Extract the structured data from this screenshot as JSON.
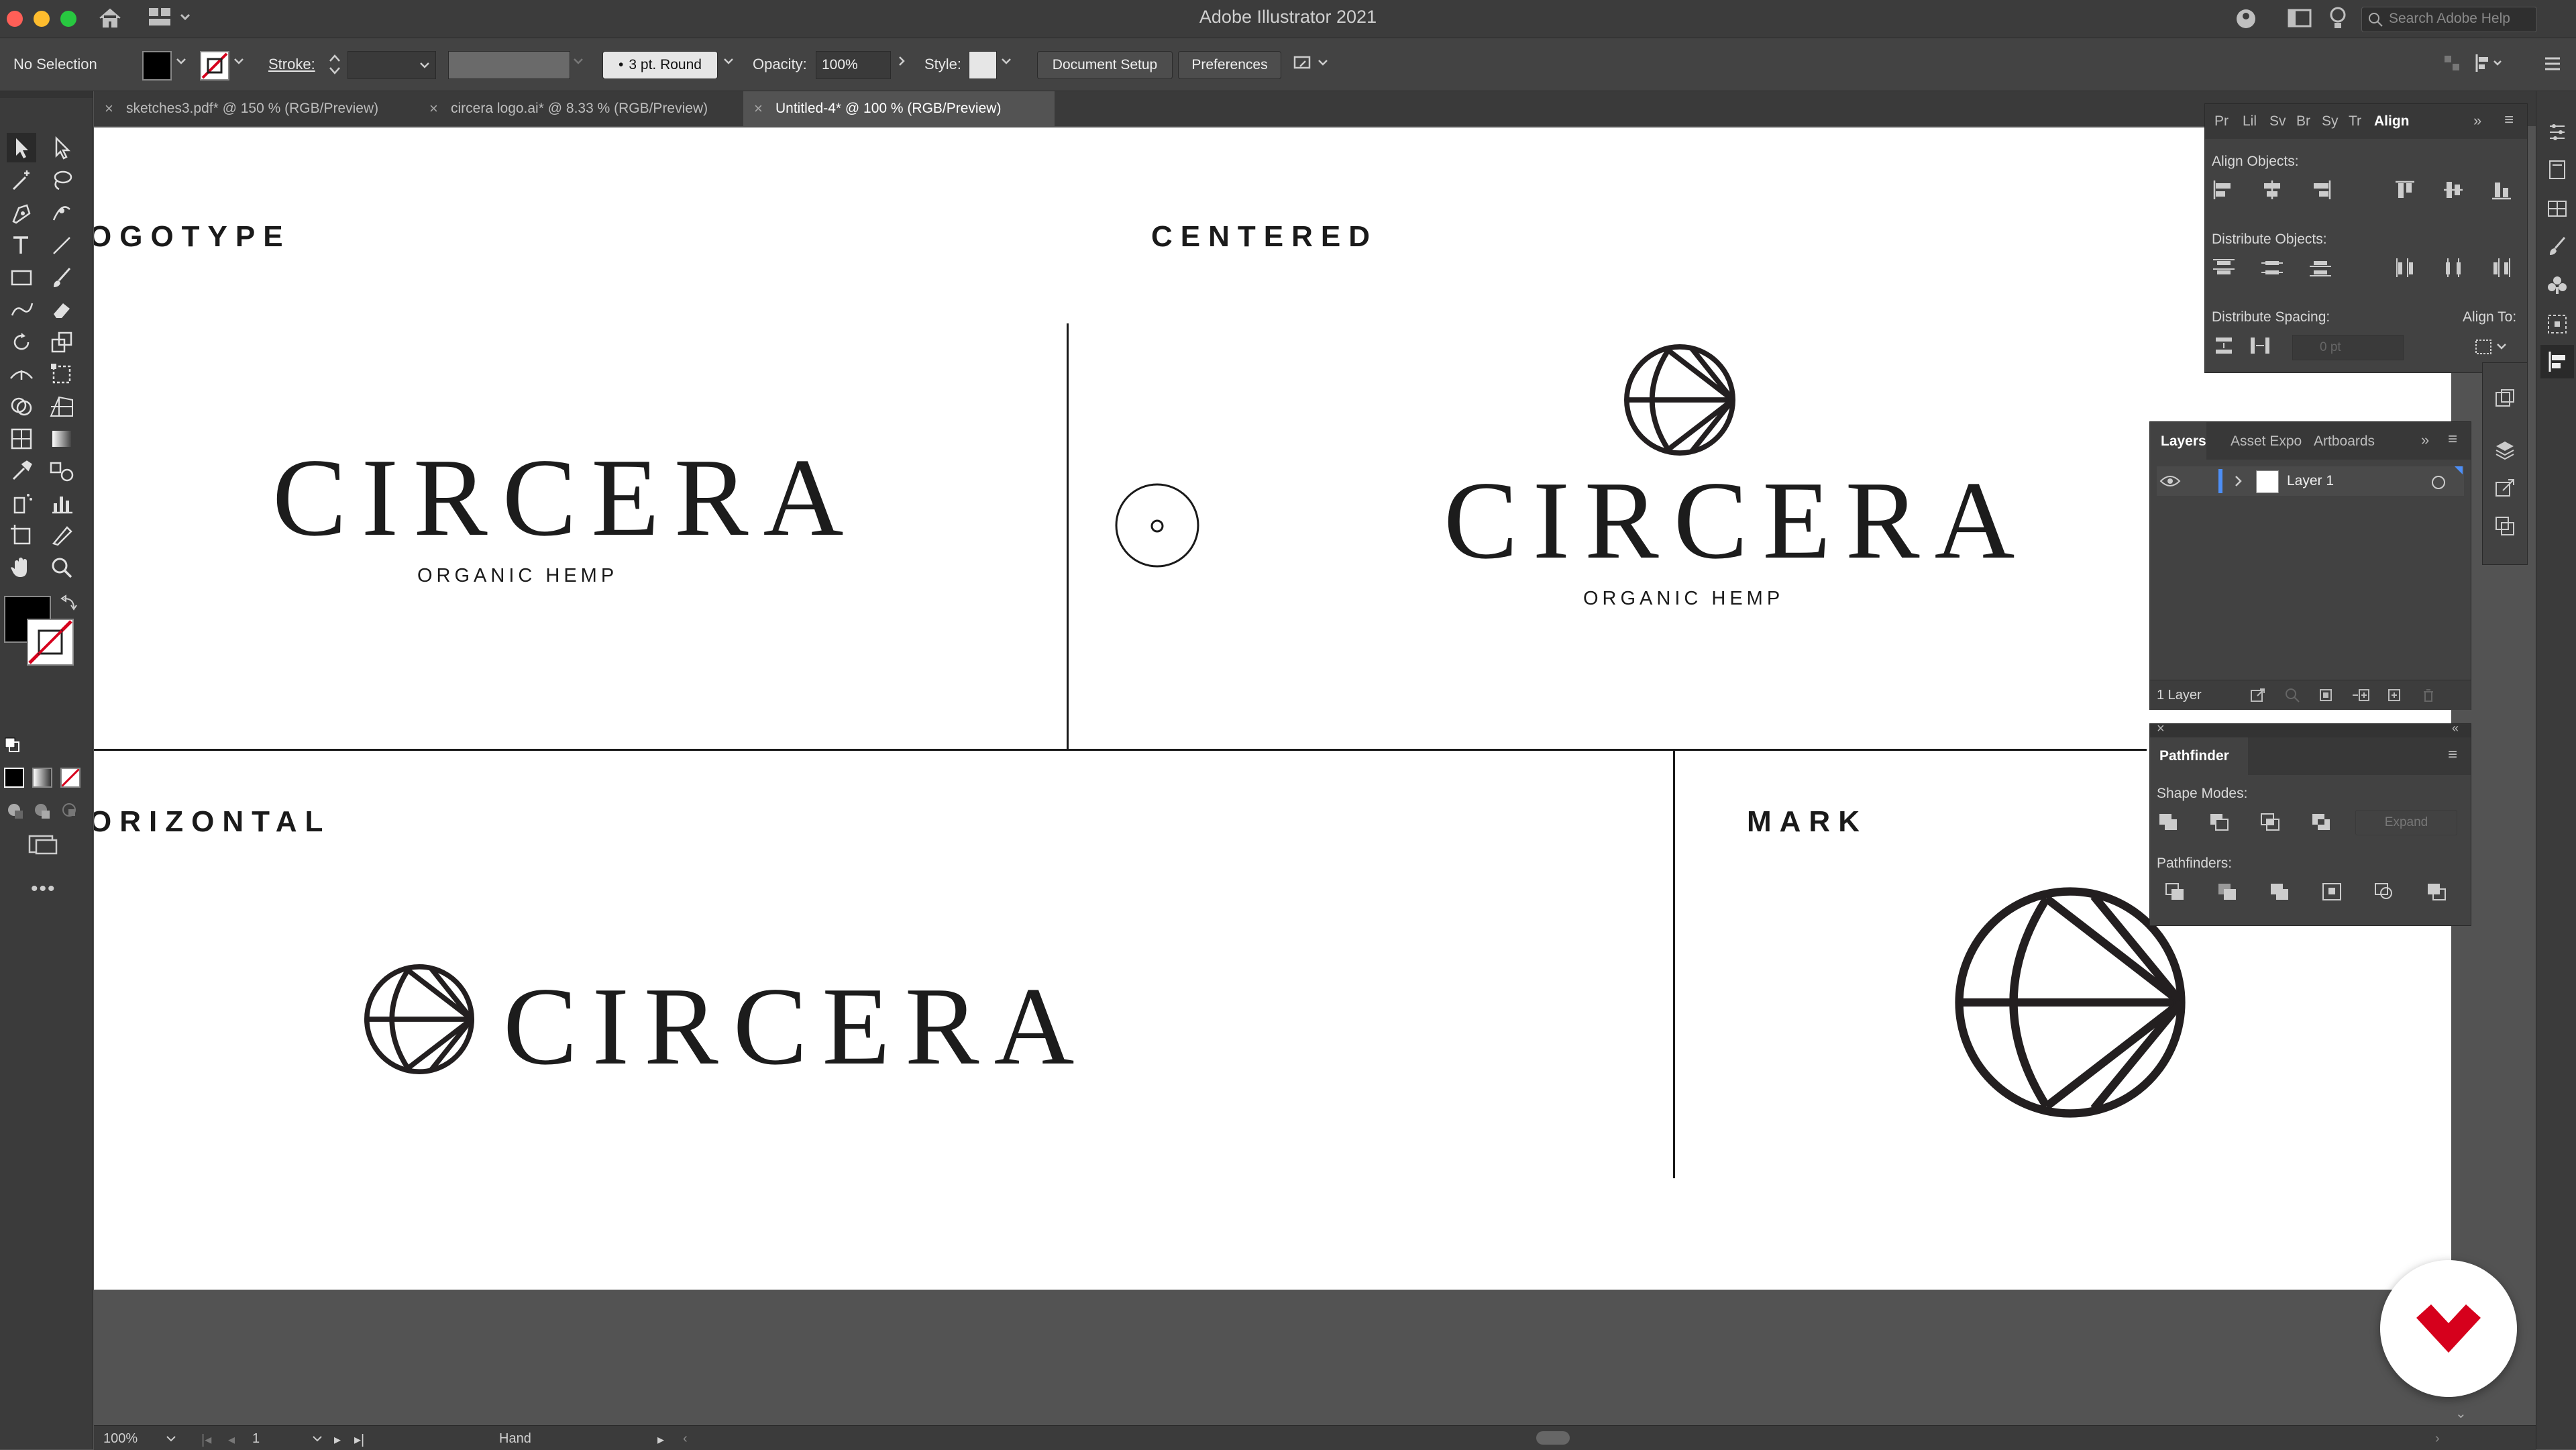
{
  "window": {
    "title": "Adobe Illustrator 2021",
    "search_placeholder": "Search Adobe Help"
  },
  "control_bar": {
    "selection": "No Selection",
    "stroke_label": "Stroke:",
    "brush": "3 pt. Round",
    "opacity_label": "Opacity:",
    "opacity_value": "100%",
    "style_label": "Style:",
    "document_setup": "Document Setup",
    "preferences": "Preferences"
  },
  "tabs": [
    {
      "label": "sketches3.pdf* @ 150 % (RGB/Preview)"
    },
    {
      "label": "circera logo.ai* @ 8.33 % (RGB/Preview)"
    },
    {
      "label": "Untitled-4* @ 100 % (RGB/Preview)"
    }
  ],
  "artboard": {
    "sections": {
      "logotype": "OGOTYPE",
      "centered": "CENTERED",
      "horizontal": "ORIZONTAL",
      "mark": "MARK"
    },
    "wordmark": "CIRCERA",
    "tagline": "ORGANIC HEMP"
  },
  "align_panel": {
    "tabs": [
      "Pr",
      "Lil",
      "Sv",
      "Br",
      "Sy",
      "Tr",
      "Align"
    ],
    "align_objects": "Align Objects:",
    "distribute_objects": "Distribute Objects:",
    "distribute_spacing": "Distribute Spacing:",
    "align_to": "Align To:",
    "spacing_value": "0 pt"
  },
  "layers_panel": {
    "tabs": [
      "Layers",
      "Asset Expo",
      "Artboards"
    ],
    "layer_name": "Layer 1",
    "count": "1 Layer"
  },
  "pathfinder_panel": {
    "title": "Pathfinder",
    "shape_modes": "Shape Modes:",
    "expand": "Expand",
    "pathfinders": "Pathfinders:"
  },
  "status_bar": {
    "zoom": "100%",
    "artboard_num": "1",
    "tool": "Hand"
  },
  "colors": {
    "accent": "#4d8ff7",
    "brand_red": "#d6001c",
    "ink": "#231f20"
  }
}
